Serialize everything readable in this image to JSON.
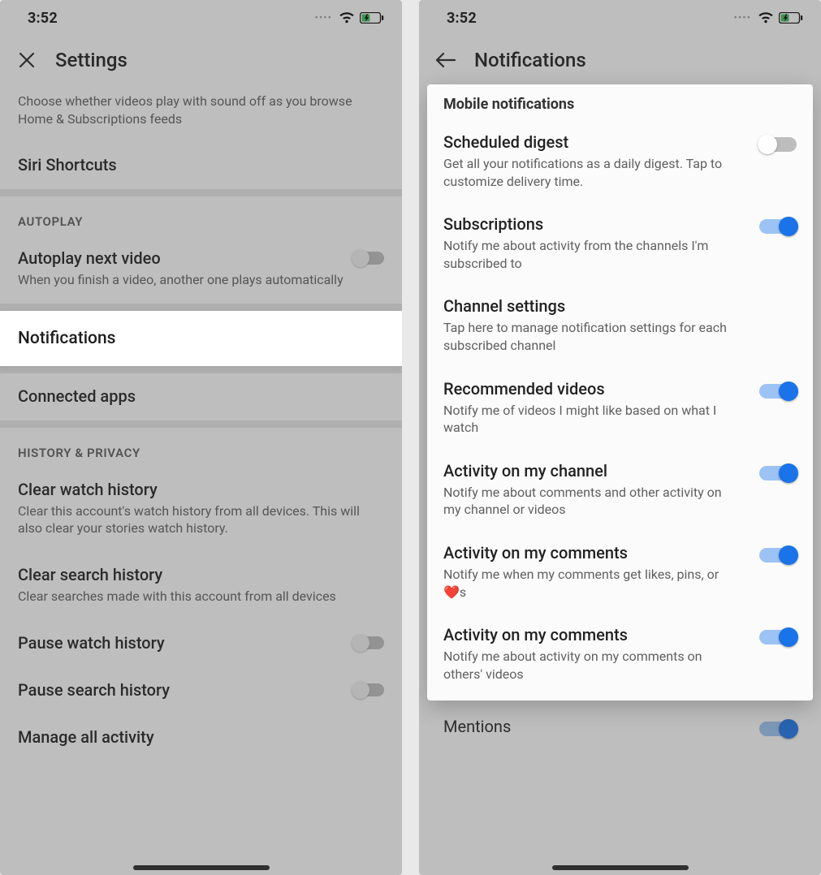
{
  "left": {
    "status": {
      "time": "3:52"
    },
    "header": {
      "title": "Settings"
    },
    "top_desc": "Choose whether videos play with sound off as you browse Home & Subscriptions feeds",
    "siri": "Siri Shortcuts",
    "section_autoplay": "AUTOPLAY",
    "autoplay": {
      "title": "Autoplay next video",
      "sub": "When you finish a video, another one plays automatically",
      "on": false
    },
    "notifications_row": "Notifications",
    "connected_apps": "Connected apps",
    "section_history": "HISTORY & PRIVACY",
    "clear_watch": {
      "title": "Clear watch history",
      "sub": "Clear this account's watch history from all devices. This will also clear your stories watch history."
    },
    "clear_search": {
      "title": "Clear search history",
      "sub": "Clear searches made with this account from all devices"
    },
    "pause_watch": {
      "title": "Pause watch history",
      "on": false
    },
    "pause_search": {
      "title": "Pause search history",
      "on": false
    },
    "manage_all": "Manage all activity"
  },
  "right": {
    "status": {
      "time": "3:52"
    },
    "header": {
      "title": "Notifications"
    },
    "card": {
      "header": "Mobile notifications",
      "items": [
        {
          "title": "Scheduled digest",
          "sub": "Get all your notifications as a daily digest. Tap to customize delivery time.",
          "on": false
        },
        {
          "title": "Subscriptions",
          "sub": "Notify me about activity from the channels I'm subscribed to",
          "on": true
        },
        {
          "title": "Channel settings",
          "sub": "Tap here to manage notification settings for each subscribed channel",
          "toggle": false
        },
        {
          "title": "Recommended videos",
          "sub": "Notify me of videos I might like based on what I watch",
          "on": true
        },
        {
          "title": "Activity on my channel",
          "sub": "Notify me about comments and other activity on my channel or videos",
          "on": true
        },
        {
          "title": "Activity on my comments",
          "sub": "Notify me when my comments get likes, pins, or ❤️s",
          "on": true
        },
        {
          "title": "Activity on my comments",
          "sub": "Notify me about activity on my comments on others' videos",
          "on": true
        }
      ]
    },
    "below": {
      "title": "Mentions",
      "on": true
    }
  }
}
